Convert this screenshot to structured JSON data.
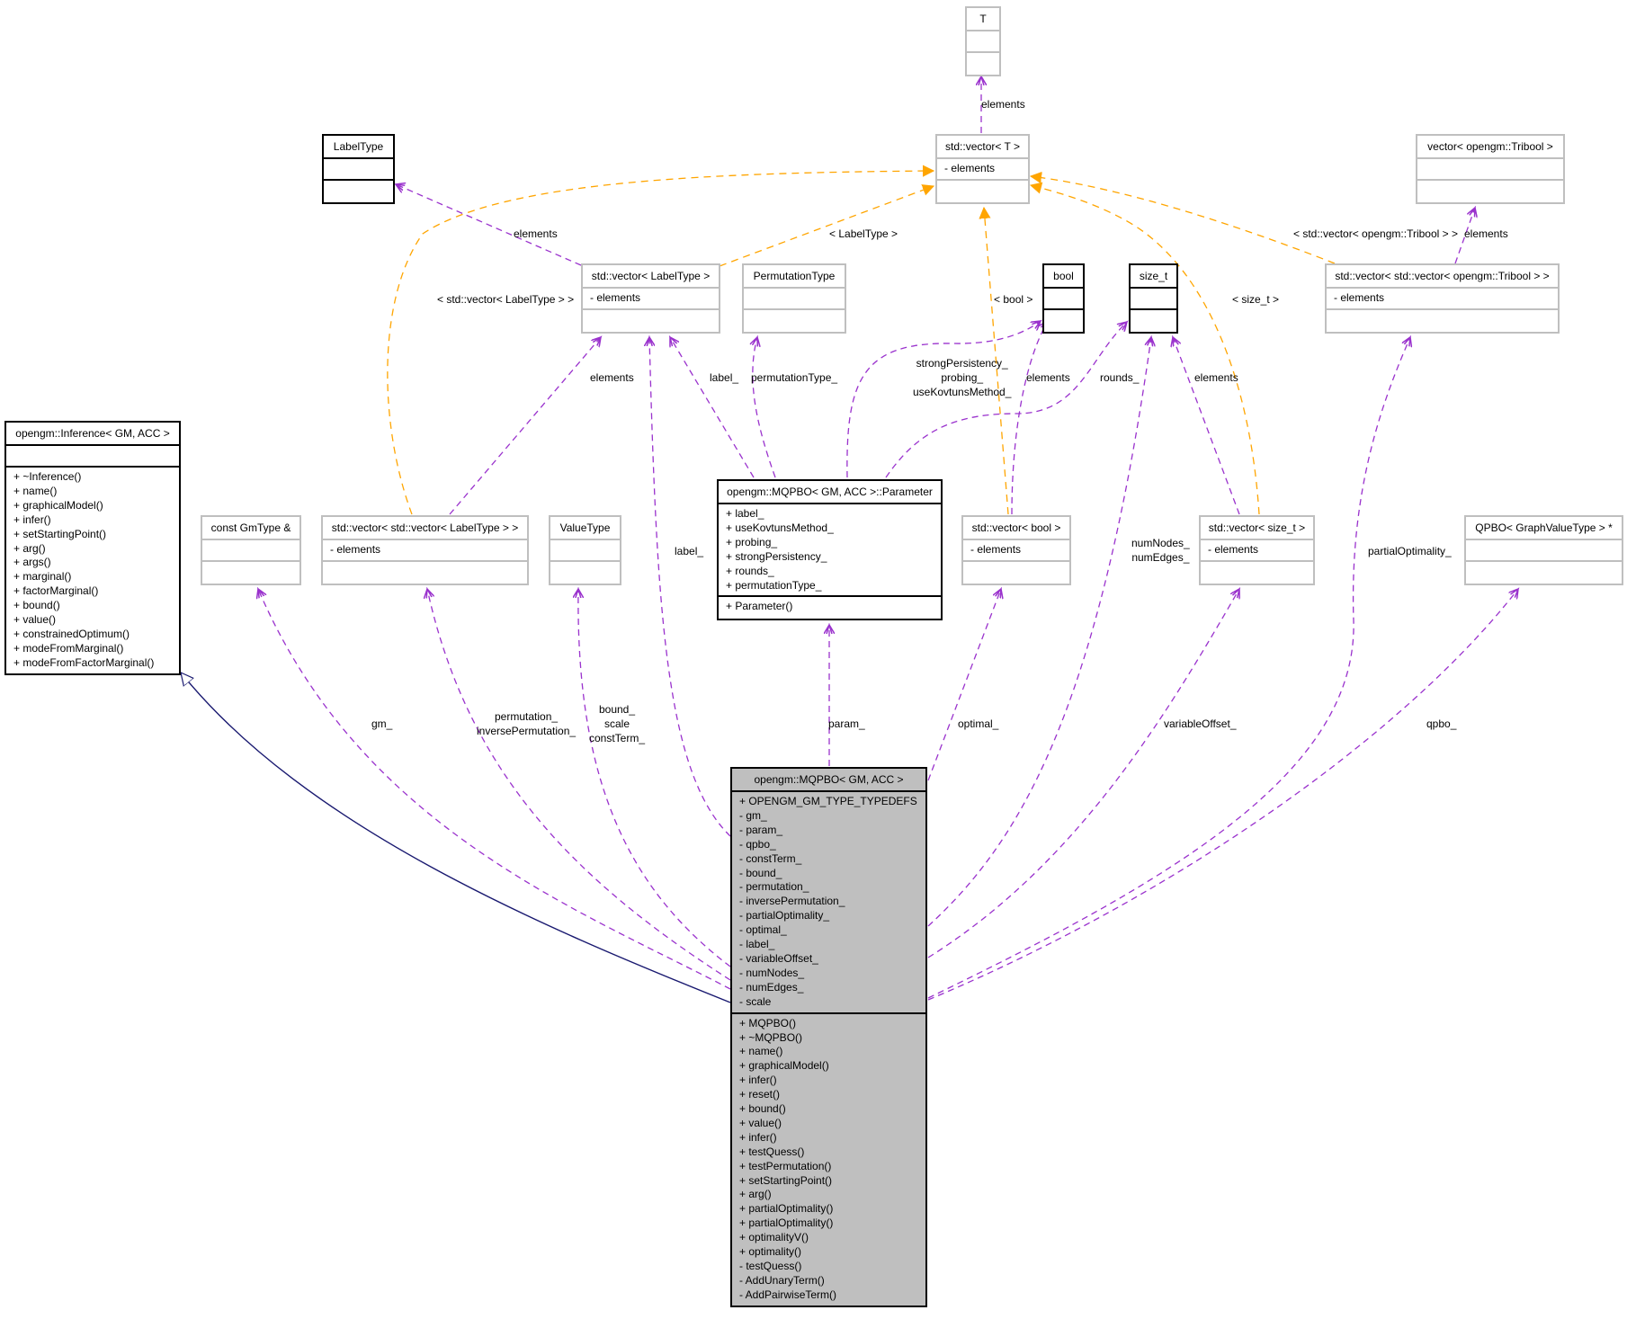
{
  "colors": {
    "member_edge": "#9a32cd",
    "template_edge": "#ffa500",
    "inheritance_edge": "#191970",
    "main_fill": "#bfbfbf",
    "gray_border": "#bfbfbf"
  },
  "nodes": {
    "T": {
      "title": "T",
      "attributes": [],
      "methods": []
    },
    "vector_T": {
      "title": "std::vector< T >",
      "attributes": [
        "- elements"
      ],
      "methods": []
    },
    "LabelType": {
      "title": "LabelType",
      "attributes": [],
      "methods": []
    },
    "vector_tribool": {
      "title": "vector< opengm::Tribool >",
      "attributes": [],
      "methods": []
    },
    "vector_LabelType": {
      "title": "std::vector< LabelType >",
      "attributes": [
        "- elements"
      ],
      "methods": []
    },
    "PermutationType": {
      "title": "PermutationType",
      "attributes": [],
      "methods": []
    },
    "bool": {
      "title": "bool",
      "attributes": [],
      "methods": []
    },
    "size_t": {
      "title": "size_t",
      "attributes": [],
      "methods": []
    },
    "vector_vector_tribool": {
      "title": "std::vector< std::vector< opengm::Tribool > >",
      "attributes": [
        "- elements"
      ],
      "methods": []
    },
    "Inference": {
      "title": "opengm::Inference< GM, ACC >",
      "attributes": [],
      "methods": [
        "+ ~Inference()",
        "+ name()",
        "+ graphicalModel()",
        "+ infer()",
        "+ setStartingPoint()",
        "+ arg()",
        "+ args()",
        "+ marginal()",
        "+ factorMarginal()",
        "+ bound()",
        "+ value()",
        "+ constrainedOptimum()",
        "+ modeFromMarginal()",
        "+ modeFromFactorMarginal()"
      ]
    },
    "GmType": {
      "title": "const GmType &",
      "attributes": [],
      "methods": []
    },
    "vector_vector_LabelType": {
      "title": "std::vector< std::vector< LabelType > >",
      "attributes": [
        "- elements"
      ],
      "methods": []
    },
    "ValueType": {
      "title": "ValueType",
      "attributes": [],
      "methods": []
    },
    "Parameter": {
      "title": "opengm::MQPBO< GM, ACC >::Parameter",
      "attributes": [
        "+ label_",
        "+ useKovtunsMethod_",
        "+ probing_",
        "+ strongPersistency_",
        "+ rounds_",
        "+ permutationType_"
      ],
      "methods": [
        "+ Parameter()"
      ]
    },
    "vector_bool": {
      "title": "std::vector< bool >",
      "attributes": [
        "- elements"
      ],
      "methods": []
    },
    "vector_size_t": {
      "title": "std::vector< size_t >",
      "attributes": [
        "- elements"
      ],
      "methods": []
    },
    "QPBO": {
      "title": "QPBO< GraphValueType > *",
      "attributes": [],
      "methods": []
    },
    "MQPBO": {
      "title": "opengm::MQPBO< GM, ACC >",
      "attributes": [
        "+ OPENGM_GM_TYPE_TYPEDEFS",
        "- gm_",
        "- param_",
        "- qpbo_",
        "- constTerm_",
        "- bound_",
        "- permutation_",
        "- inversePermutation_",
        "- partialOptimality_",
        "- optimal_",
        "- label_",
        "- variableOffset_",
        "- numNodes_",
        "- numEdges_",
        "- scale"
      ],
      "methods": [
        "+ MQPBO()",
        "+ ~MQPBO()",
        "+ name()",
        "+ graphicalModel()",
        "+ infer()",
        "+ reset()",
        "+ bound()",
        "+ value()",
        "+ infer()",
        "+ testQuess()",
        "+ testPermutation()",
        "+ setStartingPoint()",
        "+ arg()",
        "+ partialOptimality()",
        "+ partialOptimality()",
        "+ optimalityV()",
        "+ optimality()",
        "- testQuess()",
        "- AddUnaryTerm()",
        "- AddPairwiseTerm()"
      ]
    }
  },
  "edge_labels": {
    "T_elements": "elements",
    "LabelType_elements": "elements",
    "vLabelType_template": "< LabelType >",
    "vvLabelType_template": "< std::vector< LabelType > >",
    "bool_template": "< bool >",
    "size_t_template": "< size_t >",
    "vvTribool_template": "< std::vector< opengm::Tribool > >",
    "tribool_elements": "elements",
    "vvLabelType_elements": "elements",
    "param_label": "label_",
    "param_permutationType": "permutationType_",
    "param_bool_members": [
      "strongPersistency_",
      "probing_",
      "useKovtunsMethod_"
    ],
    "vbool_elements": "elements",
    "param_rounds": "rounds_",
    "vsize_t_elements": "elements",
    "main_label": "label_",
    "main_numNodes": [
      "numNodes_",
      "numEdges_"
    ],
    "main_partialOptimality": "partialOptimality_",
    "main_gm": "gm_",
    "main_permutation": [
      "permutation_",
      "inversePermutation_"
    ],
    "main_value": [
      "bound_",
      "scale",
      "constTerm_"
    ],
    "main_param": "param_",
    "main_optimal": "optimal_",
    "main_variableOffset": "variableOffset_",
    "main_qpbo": "qpbo_"
  }
}
